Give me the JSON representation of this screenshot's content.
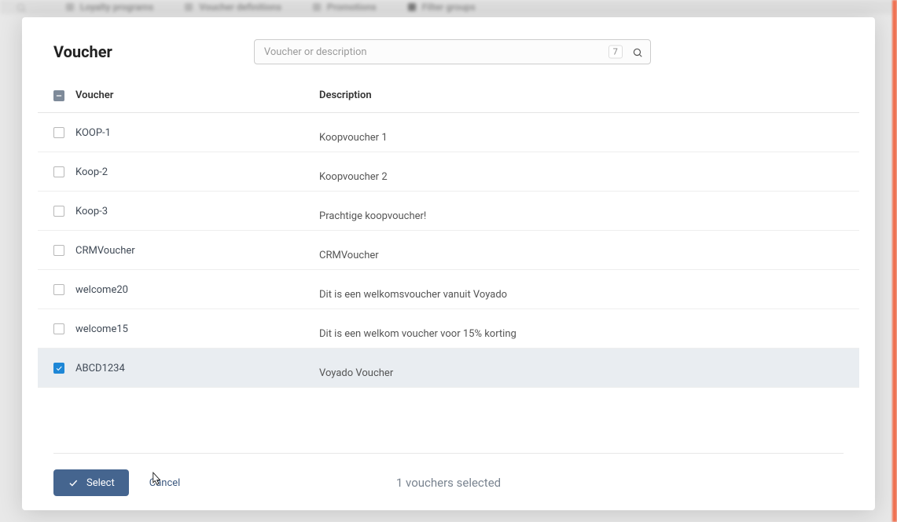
{
  "background_tabs": [
    {
      "label": "Loyalty programs"
    },
    {
      "label": "Voucher definitions"
    },
    {
      "label": "Promotions"
    },
    {
      "label": "Filter groups"
    }
  ],
  "modal": {
    "title": "Voucher",
    "search": {
      "placeholder": "Voucher or description",
      "count": "7"
    },
    "columns": {
      "voucher": "Voucher",
      "description": "Description"
    },
    "rows": [
      {
        "checked": false,
        "voucher": "KOOP-1",
        "description": "Koopvoucher 1"
      },
      {
        "checked": false,
        "voucher": "Koop-2",
        "description": "Koopvoucher 2"
      },
      {
        "checked": false,
        "voucher": "Koop-3",
        "description": "Prachtige koopvoucher!"
      },
      {
        "checked": false,
        "voucher": "CRMVoucher",
        "description": "CRMVoucher"
      },
      {
        "checked": false,
        "voucher": "welcome20",
        "description": "Dit is een welkomsvoucher vanuit Voyado"
      },
      {
        "checked": false,
        "voucher": "welcome15",
        "description": "Dit is een welkom voucher voor 15% korting"
      },
      {
        "checked": true,
        "voucher": "ABCD1234",
        "description": "Voyado Voucher"
      }
    ],
    "footer": {
      "select_label": "Select",
      "cancel_label": "Cancel",
      "status": "1 vouchers selected"
    }
  }
}
